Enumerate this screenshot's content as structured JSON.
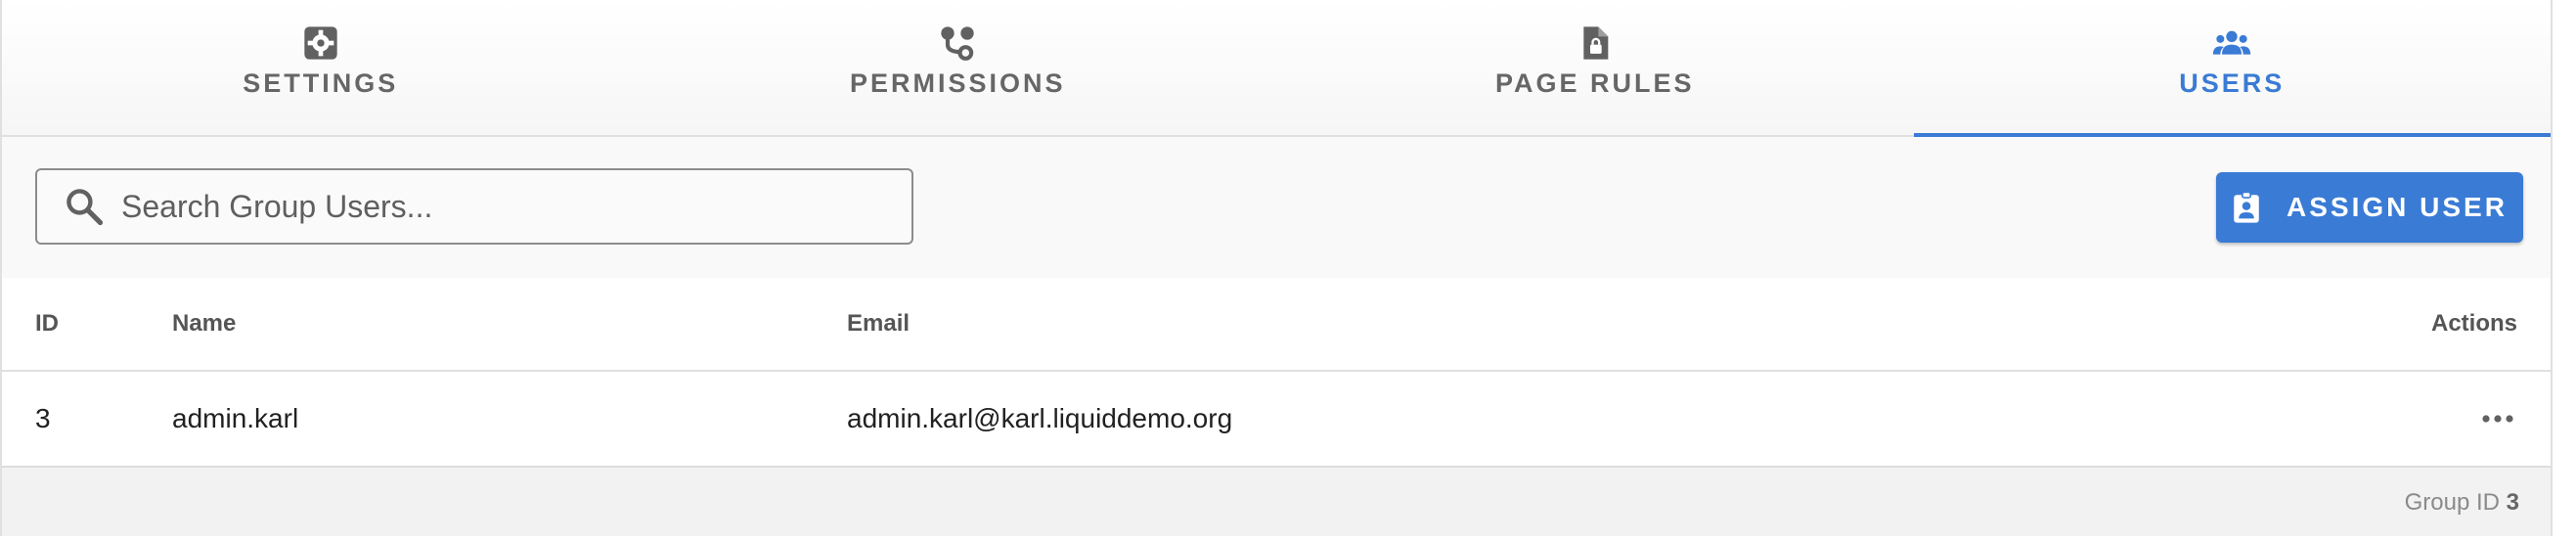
{
  "tabs": [
    {
      "label": "Settings",
      "icon": "gear-icon",
      "active": false
    },
    {
      "label": "Permissions",
      "icon": "flow-icon",
      "active": false
    },
    {
      "label": "Page Rules",
      "icon": "file-lock-icon",
      "active": false
    },
    {
      "label": "Users",
      "icon": "users-icon",
      "active": true
    }
  ],
  "toolbar": {
    "search_placeholder": "Search Group Users...",
    "search_value": "",
    "assign_label": "ASSIGN USER"
  },
  "table": {
    "columns": {
      "id": "ID",
      "name": "Name",
      "email": "Email",
      "actions": "Actions"
    },
    "rows": [
      {
        "id": "3",
        "name": "admin.karl",
        "email": "admin.karl@karl.liquiddemo.org"
      }
    ]
  },
  "footer": {
    "group_label": "Group ID",
    "group_id": "3"
  },
  "colors": {
    "accent": "#3a7bd5",
    "tab_text": "#666666",
    "border": "#e0e0e0"
  }
}
